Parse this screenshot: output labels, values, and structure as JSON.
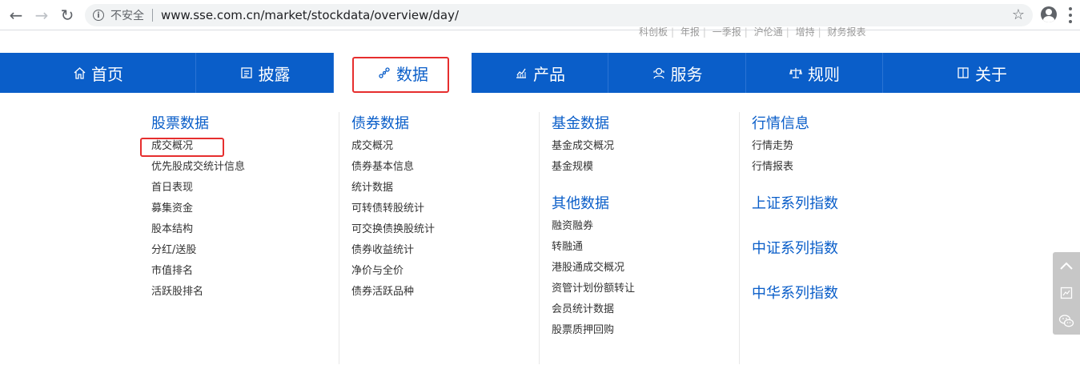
{
  "browser": {
    "security_label": "不安全",
    "url": "www.sse.com.cn/market/stockdata/overview/day/"
  },
  "top_links": [
    "科创板",
    "年报",
    "一季报",
    "沪伦通",
    "增持",
    "财务报表"
  ],
  "nav": {
    "items": [
      {
        "label": "首页",
        "icon": "home-icon"
      },
      {
        "label": "披露",
        "icon": "document-icon"
      },
      {
        "label": "数据",
        "icon": "data-nodes-icon"
      },
      {
        "label": "产品",
        "icon": "chart-icon"
      },
      {
        "label": "服务",
        "icon": "service-icon"
      },
      {
        "label": "规则",
        "icon": "scale-icon"
      },
      {
        "label": "关于",
        "icon": "book-icon"
      }
    ],
    "active_index": 2
  },
  "menu": {
    "col1": {
      "title": "股票数据",
      "links": [
        "成交概况",
        "优先股成交统计信息",
        "首日表现",
        "募集资金",
        "股本结构",
        "分红/送股",
        "市值排名",
        "活跃股排名"
      ]
    },
    "col2": {
      "title": "债券数据",
      "links": [
        "成交概况",
        "债券基本信息",
        "统计数据",
        "可转债转股统计",
        "可交换债换股统计",
        "债券收益统计",
        "净价与全价",
        "债券活跃品种"
      ]
    },
    "col3": {
      "title": "基金数据",
      "links": [
        "基金成交概况",
        "基金规模"
      ],
      "title2": "其他数据",
      "links2": [
        "融资融券",
        "转融通",
        "港股通成交概况",
        "资管计划份额转让",
        "会员统计数据",
        "股票质押回购"
      ]
    },
    "col4": {
      "title": "行情信息",
      "links": [
        "行情走势",
        "行情报表"
      ],
      "indices": [
        "上证系列指数",
        "中证系列指数",
        "中华系列指数"
      ]
    }
  },
  "colors": {
    "nav_blue": "#0a5ec9",
    "highlight_red": "#e62e2e",
    "link_text": "#333333"
  }
}
